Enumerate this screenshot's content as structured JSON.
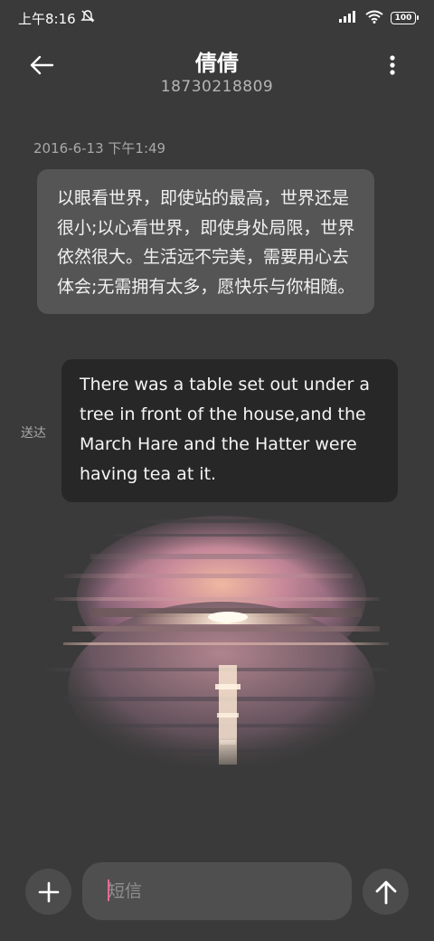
{
  "status_bar": {
    "time": "上午8:16",
    "icons": [
      "mute-icon",
      "signal-icon",
      "wifi-icon",
      "battery-icon"
    ],
    "battery": "100"
  },
  "header": {
    "contact_name": "倩倩",
    "phone_number": "18730218809",
    "back_icon": "back-arrow-icon",
    "more_icon": "more-vertical-icon"
  },
  "conversation": {
    "timestamp": "2016-6-13 下午1:49",
    "incoming_message": "以眼看世界，即使站的最高，世界还是很小;以心看世界，即使身处局限，世界依然很大。生活远不完美，需要用心去体会;无需拥有太多，愿快乐与你相随。",
    "outgoing_message": "There was a table set out under a tree in front of the house,and the March Hare and the Hatter were having tea at it.",
    "outgoing_status": "送达",
    "image_alt": "sunset-over-sea-image"
  },
  "composer": {
    "placeholder": "短信",
    "add_icon": "plus-icon",
    "send_icon": "send-arrow-icon"
  },
  "colors": {
    "background": "#3a3a3a",
    "incoming_bubble": "#555555",
    "outgoing_bubble": "#272727",
    "caret": "#e46a8f"
  }
}
